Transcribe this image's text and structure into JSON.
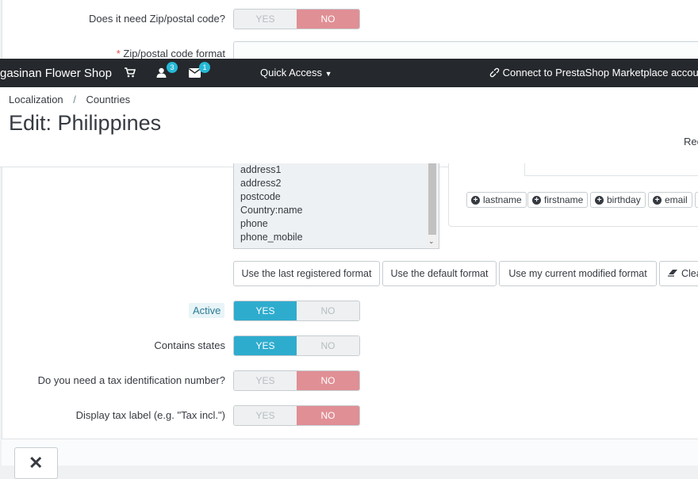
{
  "form": {
    "zip_needed": {
      "label": "Does it need Zip/postal code?",
      "yes": "YES",
      "no": "NO",
      "value": "NO"
    },
    "zip_format": {
      "required_mark": "*",
      "label": "Zip/postal code format",
      "value": ""
    },
    "address_layout": {
      "lines": [
        "address1",
        "address2",
        "postcode",
        "Country:name",
        "phone",
        "phone_mobile"
      ]
    },
    "field_chips": [
      {
        "icon": "plus-circle-icon",
        "label": "lastname"
      },
      {
        "icon": "plus-circle-icon",
        "label": "firstname"
      },
      {
        "icon": "plus-circle-icon",
        "label": "birthday"
      },
      {
        "icon": "plus-circle-icon",
        "label": "email"
      }
    ],
    "format_buttons": {
      "last_registered": "Use the last registered format",
      "default": "Use the default format",
      "current_modified": "Use my current modified format",
      "clear": "Clea"
    },
    "active": {
      "label": "Active",
      "yes": "YES",
      "no": "NO",
      "value": "YES"
    },
    "contains_states": {
      "label": "Contains states",
      "yes": "YES",
      "no": "NO",
      "value": "YES"
    },
    "tax_id": {
      "label": "Do you need a tax identification number?",
      "yes": "YES",
      "no": "NO",
      "value": "NO"
    },
    "tax_label": {
      "label": "Display tax label (e.g. \"Tax incl.\")",
      "yes": "YES",
      "no": "NO",
      "value": "NO"
    }
  },
  "topbar": {
    "shop_name": "gasinan Flower Shop",
    "cart_icon": "shopping-cart-icon",
    "customers_badge": "3",
    "messages_badge": "1",
    "quick_access": "Quick Access",
    "connect": "Connect to PrestaShop Marketplace account"
  },
  "header": {
    "breadcrumb": [
      "Localization",
      "Countries"
    ],
    "breadcrumb_sep": "/",
    "title": "Edit: Philippines",
    "right_cut": "Rec"
  },
  "colors": {
    "topbar": "#25282c",
    "yes_active": "#2eacce",
    "no_active": "#e08f95",
    "badge": "#25b9d7"
  }
}
